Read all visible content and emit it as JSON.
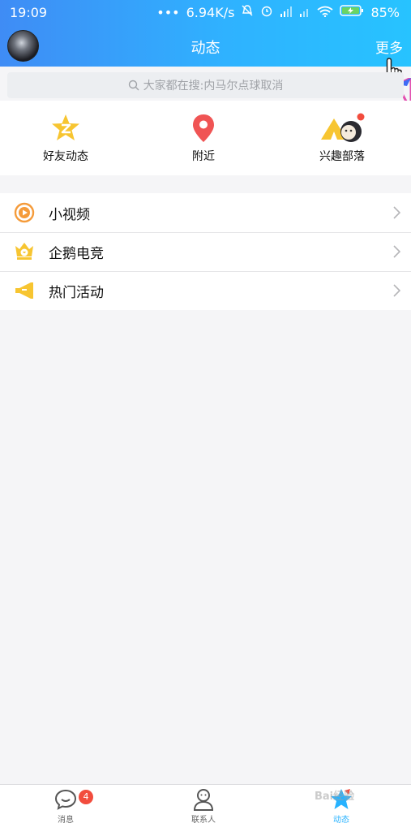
{
  "status_bar": {
    "time": "19:09",
    "network_speed": "6.94K/s",
    "battery": "85%",
    "icons": [
      "dots-icon",
      "mute-icon",
      "alarm-icon",
      "signal-icon",
      "signal-icon",
      "wifi-icon",
      "battery-charging-icon"
    ]
  },
  "header": {
    "title": "动态",
    "more_label": "更多",
    "avatar_icon": "avatar",
    "colors": {
      "gradient_start": "#3f8cf5",
      "gradient_end": "#27c3ff"
    }
  },
  "search": {
    "placeholder": "大家都在搜:内马尔点球取消",
    "icon": "search-icon"
  },
  "actions": [
    {
      "label": "好友动态",
      "icon": "qzone-star-icon",
      "color": "#f7c531"
    },
    {
      "label": "附近",
      "icon": "location-pin-icon",
      "color": "#f05454"
    },
    {
      "label": "兴趣部落",
      "icon": "tribe-tent-icon",
      "color": "#f7c531",
      "has_dot": true
    }
  ],
  "list": [
    {
      "label": "小视频",
      "icon": "video-play-icon",
      "color": "#f59b3a"
    },
    {
      "label": "企鹅电竞",
      "icon": "esports-crown-icon",
      "color": "#f7c531"
    },
    {
      "label": "热门活动",
      "icon": "megaphone-icon",
      "color": "#f7c531"
    }
  ],
  "bottom_nav": [
    {
      "label": "消息",
      "icon": "message-bubble-icon",
      "badge": "4"
    },
    {
      "label": "联系人",
      "icon": "contacts-person-icon"
    },
    {
      "label": "动态",
      "icon": "star-icon",
      "active": true
    }
  ],
  "watermark": "Bai经验"
}
